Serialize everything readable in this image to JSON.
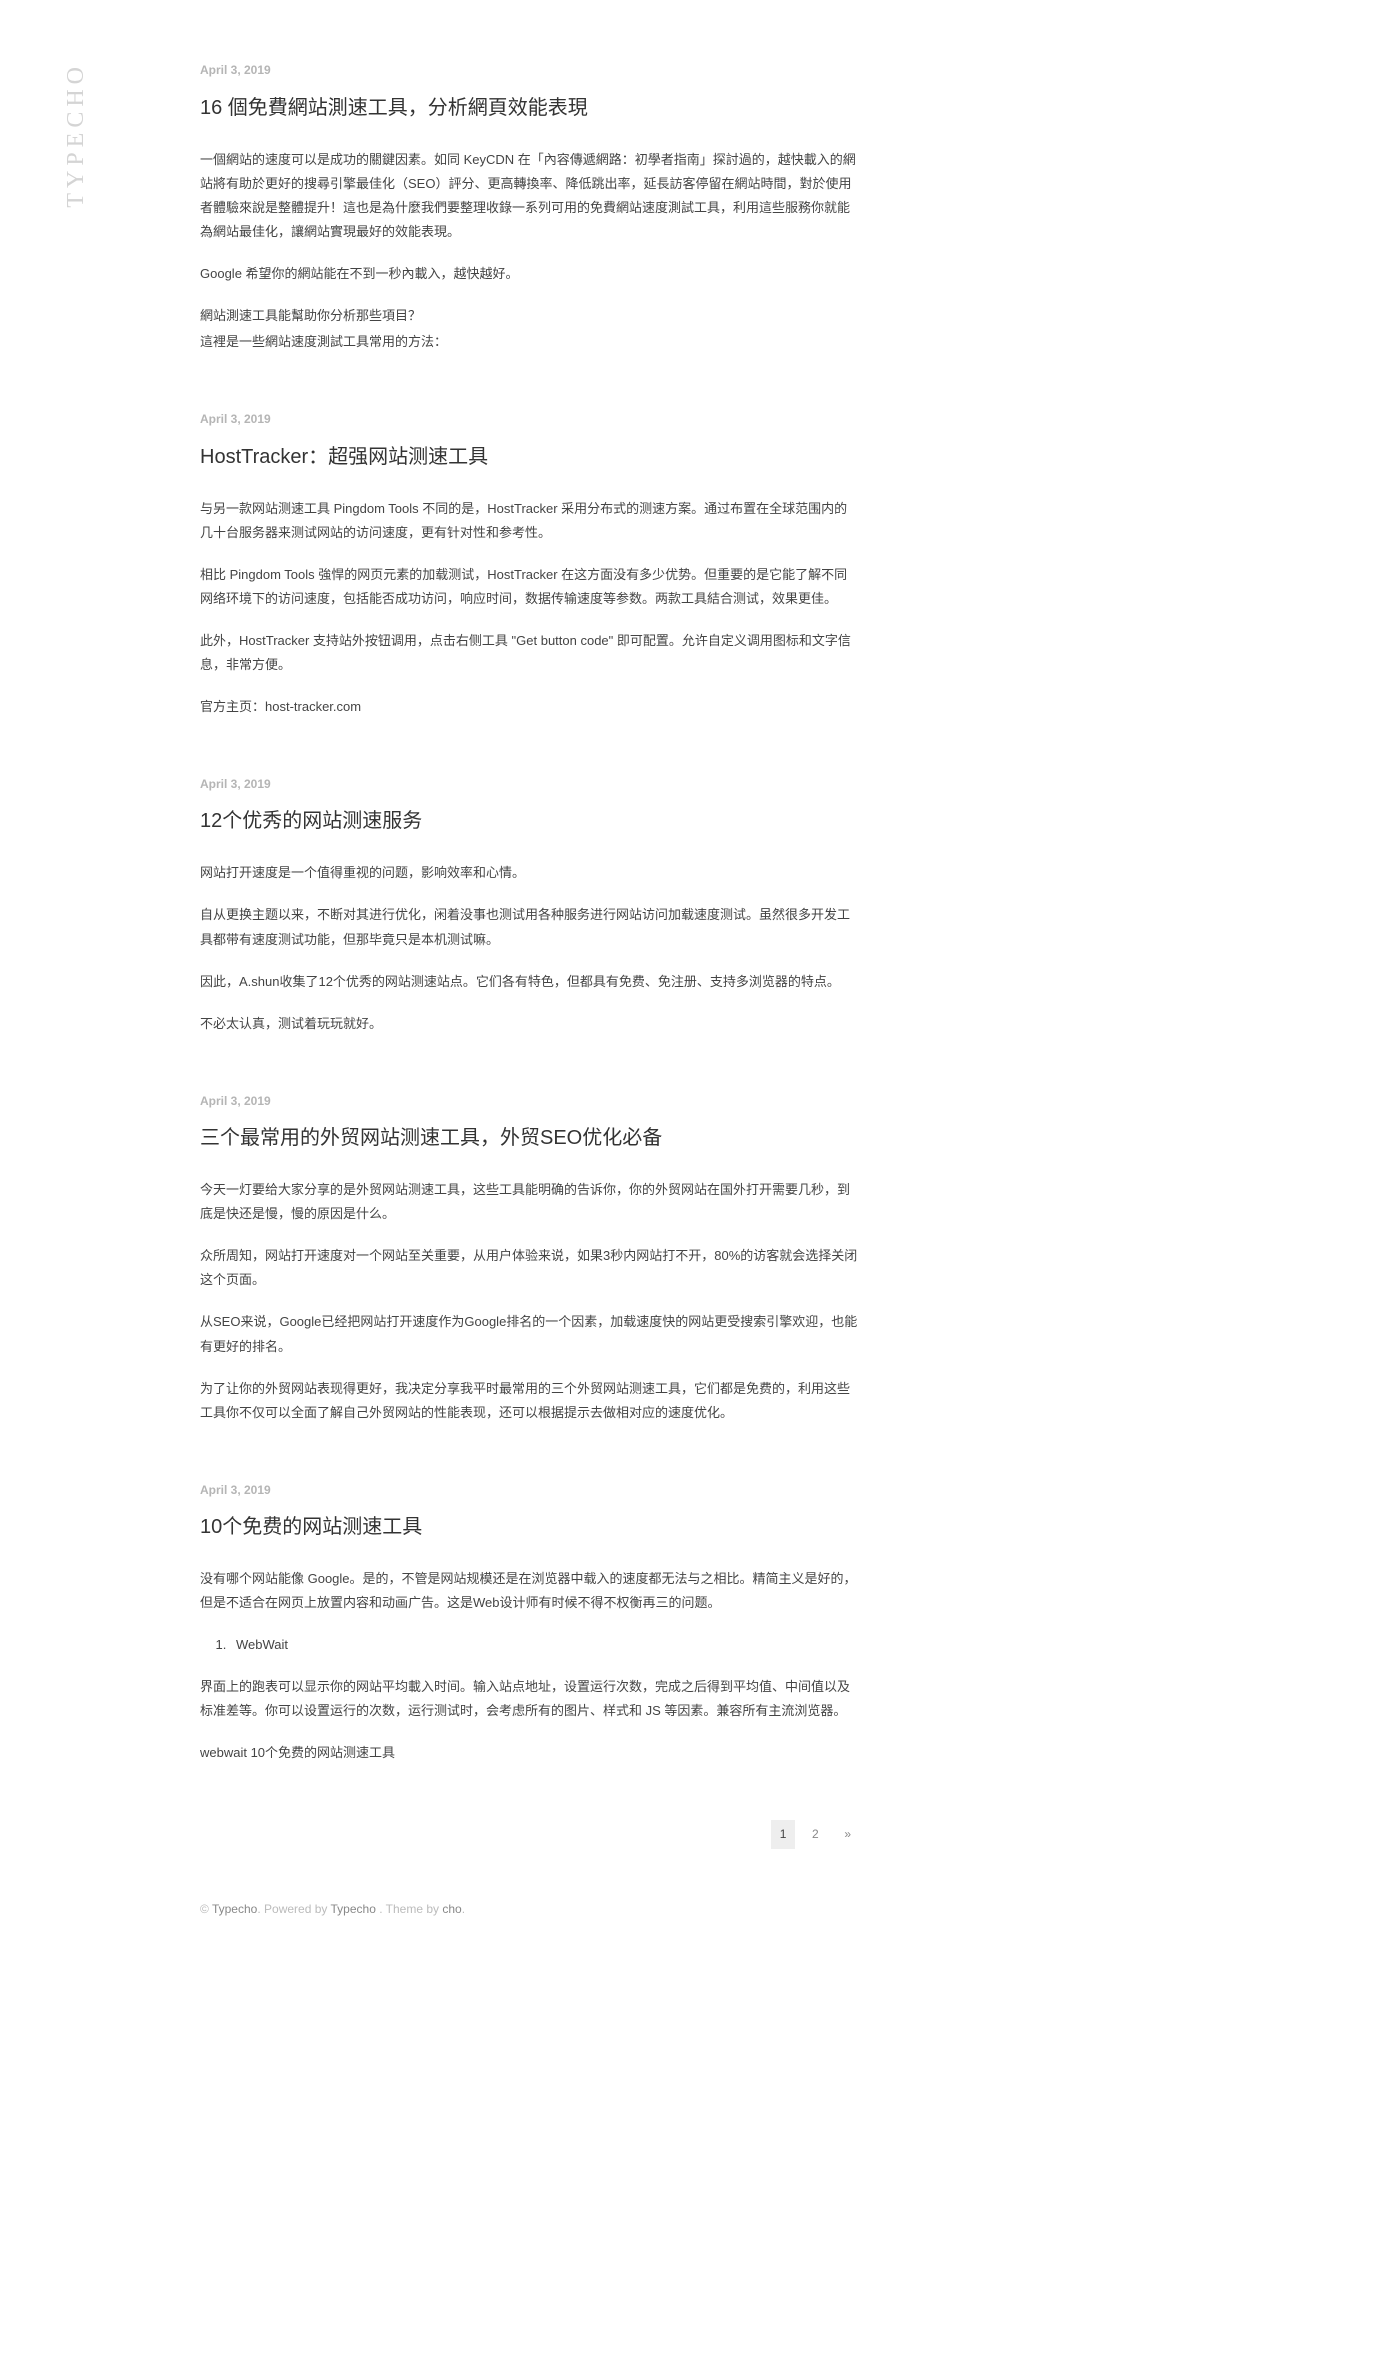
{
  "site": {
    "title": "TYPECHO"
  },
  "posts": [
    {
      "date": "April 3, 2019",
      "title": "16 個免費網站測速工具，分析網頁效能表現",
      "paragraphs": [
        "一個網站的速度可以是成功的關鍵因素。如同 KeyCDN 在「內容傳遞網路：初學者指南」探討過的，越快載入的網站將有助於更好的搜尋引擎最佳化（SEO）評分、更高轉換率、降低跳出率，延長訪客停留在網站時間，對於使用者體驗來說是整體提升！這也是為什麼我們要整理收錄一系列可用的免費網站速度測試工具，利用這些服務你就能為網站最佳化，讓網站實現最好的效能表現。",
        "Google 希望你的網站能在不到一秒內載入，越快越好。",
        "網站測速工具能幫助你分析那些項目？",
        "這裡是一些網站速度測試工具常用的方法："
      ]
    },
    {
      "date": "April 3, 2019",
      "title": "HostTracker：超强网站测速工具",
      "paragraphs": [
        "与另一款网站测速工具 Pingdom Tools 不同的是，HostTracker 采用分布式的测速方案。通过布置在全球范围内的几十台服务器来测试网站的访问速度，更有针对性和参考性。",
        "相比 Pingdom Tools 強悍的网页元素的加载测试，HostTracker 在这方面没有多少优势。但重要的是它能了解不同网络环境下的访问速度，包括能否成功访问，响应时间，数据传输速度等参数。两款工具結合测试，效果更佳。",
        "此外，HostTracker 支持站外按钮调用，点击右侧工具 \"Get button code\" 即可配置。允许自定义调用图标和文字信息，非常方便。",
        "官方主页：host-tracker.com"
      ]
    },
    {
      "date": "April 3, 2019",
      "title": "12个优秀的网站测速服务",
      "paragraphs": [
        "网站打开速度是一个值得重视的问题，影响效率和心情。",
        "自从更换主题以来，不断对其进行优化，闲着没事也测试用各种服务进行网站访问加载速度测试。虽然很多开发工具都带有速度测试功能，但那毕竟只是本机测试嘛。",
        "因此，A.shun收集了12个优秀的网站测速站点。它们各有特色，但都具有免费、免注册、支持多浏览器的特点。",
        "不必太认真，测试着玩玩就好。"
      ]
    },
    {
      "date": "April 3, 2019",
      "title": "三个最常用的外贸网站测速工具，外贸SEO优化必备",
      "paragraphs": [
        "今天一灯要给大家分享的是外贸网站测速工具，这些工具能明确的告诉你，你的外贸网站在国外打开需要几秒，到底是快还是慢，慢的原因是什么。",
        "众所周知，网站打开速度对一个网站至关重要，从用户体验来说，如果3秒内网站打不开，80%的访客就会选择关闭这个页面。",
        "从SEO来说，Google已经把网站打开速度作为Google排名的一个因素，加载速度快的网站更受搜索引擎欢迎，也能有更好的排名。",
        "为了让你的外贸网站表现得更好，我决定分享我平时最常用的三个外贸网站测速工具，它们都是免费的，利用这些工具你不仅可以全面了解自己外贸网站的性能表现，还可以根据提示去做相对应的速度优化。"
      ]
    },
    {
      "date": "April 3, 2019",
      "title": "10个免费的网站测速工具",
      "paragraphs": [
        "没有哪个网站能像 Google。是的，不管是网站规模还是在浏览器中载入的速度都无法与之相比。精简主义是好的，但是不适合在网页上放置内容和动画广告。这是Web设计师有时候不得不权衡再三的问题。"
      ],
      "list": [
        "WebWait"
      ],
      "paragraphs_after": [
        "界面上的跑表可以显示你的网站平均載入时间。输入站点地址，设置运行次数，完成之后得到平均值、中间值以及标准差等。你可以设置运行的次数，运行测试时，会考虑所有的图片、样式和 JS 等因素。兼容所有主流浏览器。",
        "webwait 10个免费的网站测速工具"
      ]
    }
  ],
  "pagination": {
    "current": "1",
    "pages": [
      "2"
    ],
    "next": "»"
  },
  "footer": {
    "copyright": "© ",
    "brand1": "Typecho",
    "sep1": ". Powered by ",
    "brand2": "Typecho",
    "sep2": " . Theme by ",
    "author": "cho",
    "tail": "."
  }
}
